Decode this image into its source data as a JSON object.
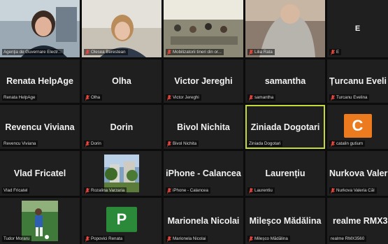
{
  "app": {
    "view": "Gallery View"
  },
  "colors": {
    "tile_bg": "#1f1f1f",
    "speaking_outline": "#c6d93a",
    "avatar_orange": "#ec7a1e",
    "avatar_green": "#2a8a3a",
    "mute_red": "#e8483f"
  },
  "participants": [
    {
      "label": "Agenţia de Guvernare Electr...",
      "video": true,
      "muted": false
    },
    {
      "label": "Olesea Berestean",
      "video": true,
      "muted": true
    },
    {
      "label": "Mobilizatorii tineri din or...",
      "video": true,
      "muted": true
    },
    {
      "label": "Lilia Rata",
      "video": true,
      "muted": true
    },
    {
      "name": "E",
      "label": "E",
      "muted": true
    },
    {
      "name": "Renata HelpAge",
      "label": "Renata HelpAge",
      "muted": false
    },
    {
      "name": "Olha",
      "label": "Olha",
      "muted": true
    },
    {
      "name": "Victor Jereghi",
      "label": "Victor Jereghi",
      "muted": true
    },
    {
      "name": "samantha",
      "label": "samantha",
      "muted": true
    },
    {
      "name": "Țurcanu Eveli",
      "label": "Turcanu Evelina",
      "muted": true
    },
    {
      "name": "Revencu Viviana",
      "label": "Revencu Viviana",
      "muted": false
    },
    {
      "name": "Dorin",
      "label": "Dorin",
      "muted": true
    },
    {
      "name": "Bivol Nichita",
      "label": "Bivol Nichita",
      "muted": true
    },
    {
      "name": "Ziniada Dogotari",
      "label": "Ziniada Dogotari",
      "muted": false,
      "speaking": true
    },
    {
      "avatar_letter": "C",
      "label": "catalin gutium",
      "muted": true
    },
    {
      "name": "Vlad Fricatel",
      "label": "Vlad Fricatel",
      "muted": false
    },
    {
      "label": "Rozalina Varzaria",
      "video": true,
      "muted": true
    },
    {
      "name": "iPhone - Calancea",
      "label": "iPhone - Calancea",
      "muted": true
    },
    {
      "name": "Laurențiu",
      "label": "Laurentiu",
      "muted": true
    },
    {
      "name": "Nurkova Valer",
      "label": "Nurkova Valeria Căl",
      "muted": true
    },
    {
      "label": "Tudor Moraru",
      "video": true,
      "muted": false
    },
    {
      "avatar_letter": "P",
      "label": "Popovici Renata",
      "muted": true
    },
    {
      "name": "Marionela Nicolai",
      "label": "Marionela Nicolai",
      "muted": true
    },
    {
      "name": "Mileșco Mădălina",
      "label": "Mileșco Mădălina",
      "muted": true
    },
    {
      "name": "realme RMX35",
      "label": "realme RMX3560",
      "muted": false
    }
  ]
}
